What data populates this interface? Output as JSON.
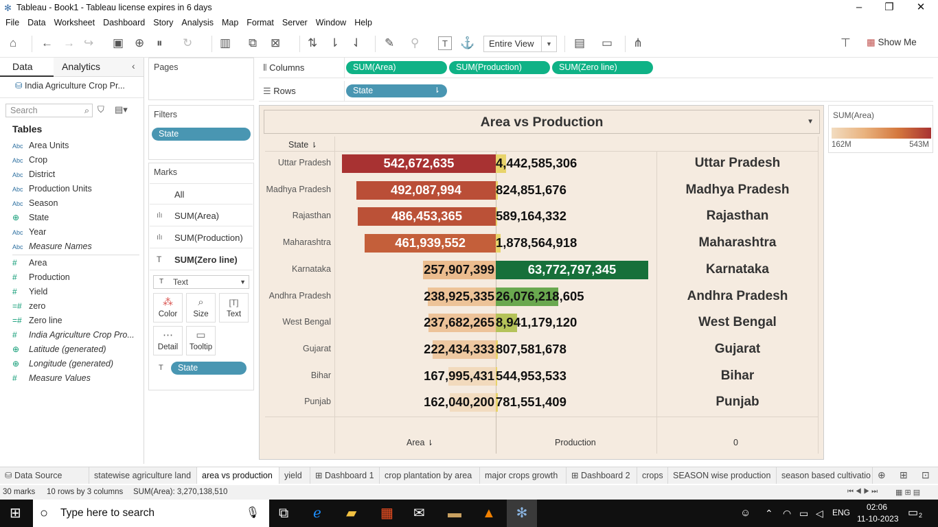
{
  "window": {
    "title": "Tableau - Book1 - Tableau license expires in 6 days"
  },
  "menu": [
    "File",
    "Data",
    "Worksheet",
    "Dashboard",
    "Story",
    "Analysis",
    "Map",
    "Format",
    "Server",
    "Window",
    "Help"
  ],
  "toolbar": {
    "view_mode": "Entire View",
    "show_me": "Show Me"
  },
  "data_pane": {
    "tab_data": "Data",
    "tab_analytics": "Analytics",
    "datasource": "India Agriculture Crop Pr...",
    "search_placeholder": "Search",
    "tables_header": "Tables",
    "fields": [
      {
        "type": "Abc",
        "name": "Area Units",
        "italic": false
      },
      {
        "type": "Abc",
        "name": "Crop",
        "italic": false
      },
      {
        "type": "Abc",
        "name": "District",
        "italic": false
      },
      {
        "type": "Abc",
        "name": "Production Units",
        "italic": false
      },
      {
        "type": "Abc",
        "name": "Season",
        "italic": false
      },
      {
        "type": "globe",
        "name": "State",
        "italic": false
      },
      {
        "type": "Abc",
        "name": "Year",
        "italic": false
      },
      {
        "type": "Abc",
        "name": "Measure Names",
        "italic": true
      },
      {
        "type": "#",
        "name": "Area",
        "italic": false
      },
      {
        "type": "#",
        "name": "Production",
        "italic": false
      },
      {
        "type": "#",
        "name": "Yield",
        "italic": false
      },
      {
        "type": "=#",
        "name": "zero",
        "italic": false
      },
      {
        "type": "=#",
        "name": "Zero line",
        "italic": false
      },
      {
        "type": "#",
        "name": "India Agriculture Crop Pro...",
        "italic": true
      },
      {
        "type": "globe",
        "name": "Latitude (generated)",
        "italic": true
      },
      {
        "type": "globe",
        "name": "Longitude (generated)",
        "italic": true
      },
      {
        "type": "#",
        "name": "Measure Values",
        "italic": true
      }
    ]
  },
  "cards": {
    "pages": "Pages",
    "filters": "Filters",
    "filter_pill": "State",
    "marks": "Marks",
    "marks_rows": [
      "All",
      "SUM(Area)",
      "SUM(Production)",
      "SUM(Zero line)"
    ],
    "mark_type": "Text",
    "mark_buttons": [
      "Color",
      "Size",
      "Text",
      "Detail",
      "Tooltip"
    ],
    "marks_pill": "State"
  },
  "shelves": {
    "columns_label": "Columns",
    "rows_label": "Rows",
    "columns": [
      "SUM(Area)",
      "SUM(Production)",
      "SUM(Zero line)"
    ],
    "rows": [
      "State"
    ]
  },
  "view": {
    "title": "Area vs Production",
    "row_header": "State",
    "footer": {
      "area": "Area",
      "production": "Production",
      "zero": "0"
    }
  },
  "chart_data": {
    "type": "bar",
    "title": "Area vs Production",
    "categories": [
      "Uttar Pradesh",
      "Madhya Pradesh",
      "Rajasthan",
      "Maharashtra",
      "Karnataka",
      "Andhra Pradesh",
      "West Bengal",
      "Gujarat",
      "Bihar",
      "Punjab"
    ],
    "series": [
      {
        "name": "Area",
        "values": [
          542672635,
          492087994,
          486453365,
          461939552,
          257907399,
          238925335,
          237682265,
          222434333,
          167995431,
          162040200
        ],
        "labels": [
          "542,672,635",
          "492,087,994",
          "486,453,365",
          "461,939,552",
          "257,907,399",
          "238,925,335",
          "237,682,265",
          "222,434,333",
          "167,995,431",
          "162,040,200"
        ]
      },
      {
        "name": "Production",
        "values": [
          4442585306,
          824851676,
          589164332,
          1878564918,
          63772797345,
          26076218605,
          8941179120,
          807581678,
          544953533,
          781551409
        ],
        "labels": [
          "4,442,585,306",
          "824,851,676",
          "589,164,332",
          "1,878,564,918",
          "63,772,797,345",
          "26,076,218,605",
          "8,941,179,120",
          "807,581,678",
          "544,953,533",
          "781,551,409"
        ]
      }
    ],
    "xlabel": "",
    "ylabel": "State"
  },
  "legend": {
    "title": "SUM(Area)",
    "min_label": "162M",
    "max_label": "543M",
    "colors": [
      "#f2dcc0",
      "#e9b27e",
      "#d4783e",
      "#a83232"
    ]
  },
  "sheet_tabs": [
    "Data Source",
    "statewise agriculture land",
    "area vs production",
    "yield",
    "Dashboard 1",
    "crop plantation by area",
    "major crops growth",
    "Dashboard 2",
    "crops",
    "SEASON wise production",
    "season based cultivatio"
  ],
  "status": {
    "marks": "30 marks",
    "rows": "10 rows by 3 columns",
    "sum": "SUM(Area): 3,270,138,510"
  },
  "taskbar": {
    "search": "Type here to search",
    "lang": "ENG",
    "time": "02:06",
    "date": "11-10-2023",
    "notif": "2"
  }
}
